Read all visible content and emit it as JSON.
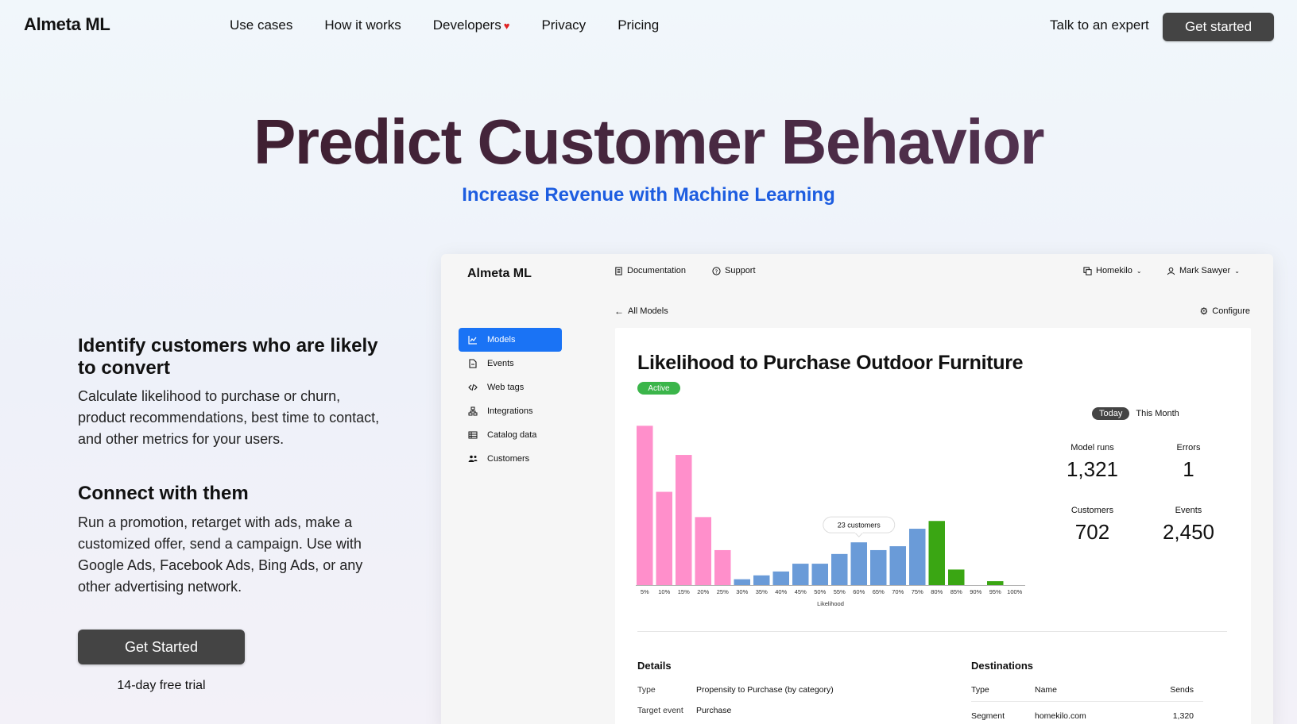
{
  "nav": {
    "brand": "Almeta ML",
    "links": [
      "Use cases",
      "How it works",
      "Developers",
      "Privacy",
      "Pricing"
    ],
    "talk": "Talk to an expert",
    "cta": "Get started"
  },
  "hero": {
    "title": "Predict Customer Behavior",
    "subtitle": "Increase Revenue with Machine Learning"
  },
  "features": [
    {
      "title": "Identify customers who are likely to convert",
      "body": "Calculate likelihood to purchase or churn, product recommendations, best time to contact, and other metrics for your users."
    },
    {
      "title": "Connect with them",
      "body": "Run a promotion, retarget with ads, make a customized offer, send a campaign. Use with Google Ads, Facebook Ads, Bing Ads, or any other advertising network."
    }
  ],
  "cta": {
    "label": "Get Started",
    "note": "14-day free trial"
  },
  "app": {
    "brand": "Almeta ML",
    "top": {
      "documentation": "Documentation",
      "support": "Support",
      "workspace": "Homekilo",
      "user": "Mark Sawyer"
    },
    "sidebar": [
      {
        "label": "Models",
        "icon": "chart-icon"
      },
      {
        "label": "Events",
        "icon": "document-icon"
      },
      {
        "label": "Web tags",
        "icon": "code-icon"
      },
      {
        "label": "Integrations",
        "icon": "integrations-icon"
      },
      {
        "label": "Catalog data",
        "icon": "table-icon"
      },
      {
        "label": "Customers",
        "icon": "users-icon"
      }
    ],
    "back": "All Models",
    "configure": "Configure",
    "model": {
      "title": "Likelihood to Purchase Outdoor Furniture",
      "status": "Active",
      "toggle": {
        "today": "Today",
        "month": "This Month"
      },
      "stats": [
        {
          "label": "Model runs",
          "value": "1,321"
        },
        {
          "label": "Errors",
          "value": "1"
        },
        {
          "label": "Customers",
          "value": "702"
        },
        {
          "label": "Events",
          "value": "2,450"
        }
      ]
    },
    "details": {
      "heading": "Details",
      "rows": [
        {
          "key": "Type",
          "value": "Propensity to Purchase (by category)"
        },
        {
          "key": "Target event",
          "value": "Purchase"
        }
      ]
    },
    "destinations": {
      "heading": "Destinations",
      "columns": [
        "Type",
        "Name",
        "Sends"
      ],
      "rows": [
        {
          "type": "Segment",
          "name": "homekilo.com",
          "sends": "1,320"
        }
      ]
    }
  },
  "colors": {
    "pink": "#ff8fcb",
    "blue": "#6a9bd8",
    "green": "#3aa613",
    "accent": "#1a73f5"
  },
  "chart_data": {
    "type": "bar",
    "xlabel": "Likelihood",
    "categories": [
      "5%",
      "10%",
      "15%",
      "20%",
      "25%",
      "30%",
      "35%",
      "40%",
      "45%",
      "50%",
      "55%",
      "60%",
      "65%",
      "70%",
      "75%",
      "80%",
      "85%",
      "90%",
      "95%",
      "100%"
    ],
    "values": [
      82,
      48,
      67,
      35,
      18,
      3,
      5,
      7,
      11,
      11,
      16,
      22,
      18,
      20,
      29,
      33,
      8,
      0,
      2,
      0
    ],
    "colors": [
      "pink",
      "pink",
      "pink",
      "pink",
      "pink",
      "blue",
      "blue",
      "blue",
      "blue",
      "blue",
      "blue",
      "blue",
      "blue",
      "blue",
      "blue",
      "green",
      "green",
      "green",
      "green",
      "green"
    ],
    "annotation": {
      "text": "23 customers",
      "category": "60%"
    },
    "ylim": [
      0,
      85
    ]
  }
}
